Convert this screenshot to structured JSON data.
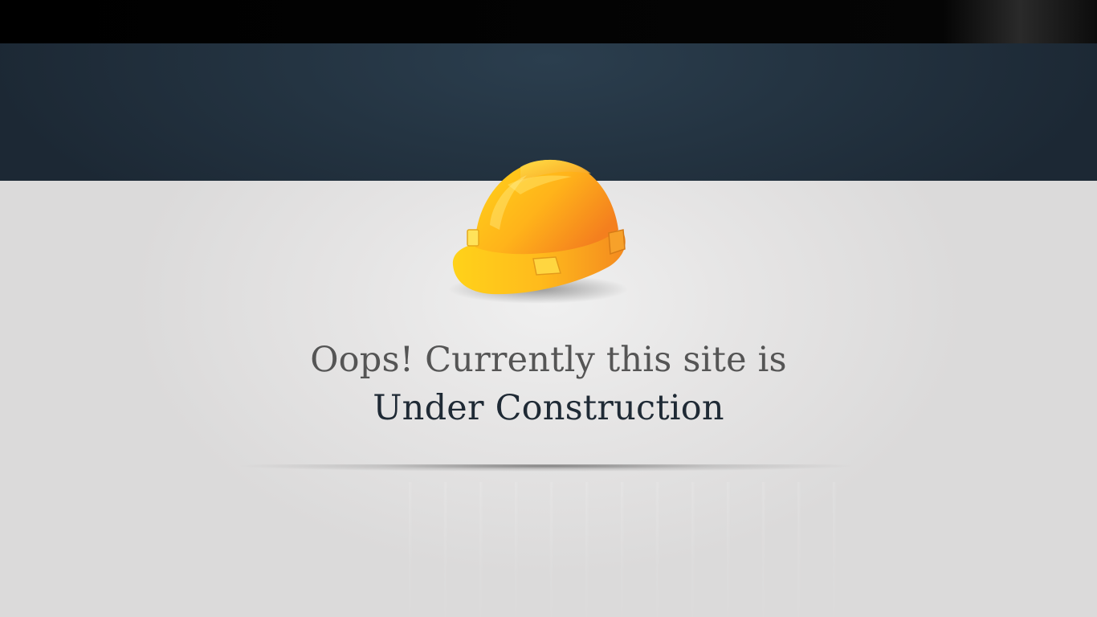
{
  "message": {
    "line1": "Oops! Currently this site is",
    "line2": "Under Construction"
  },
  "icons": {
    "hero": "hard-hat-icon"
  },
  "colors": {
    "top_bar": "#000000",
    "header_band": "#243442",
    "background": "#dcdbdb",
    "line1_text": "#555555",
    "line2_text": "#1f2a35",
    "helmet_yellow": "#ffc21a",
    "helmet_orange": "#f7941d"
  }
}
